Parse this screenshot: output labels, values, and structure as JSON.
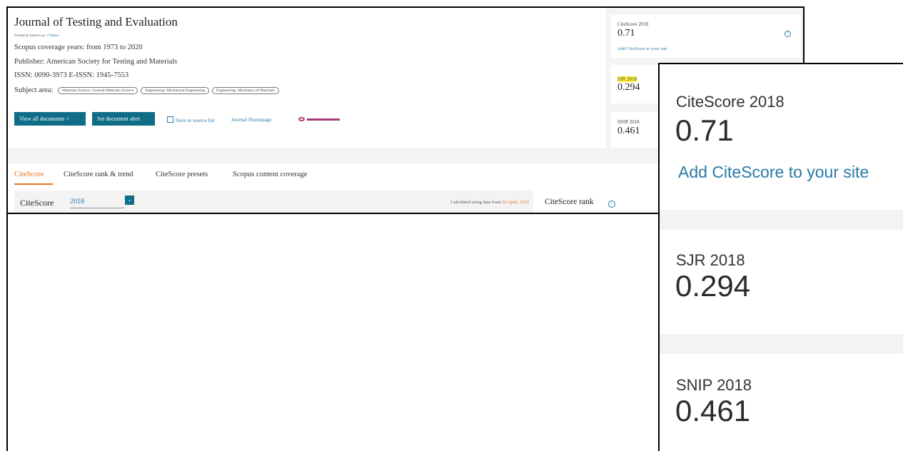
{
  "journal": {
    "title": "Journal of Testing and Evaluation",
    "formerly_label": "Formerly known as:",
    "formerly_link": "J Mater",
    "coverage": "Scopus coverage years:  from 1973 to 2020",
    "publisher": "Publisher:  American Society for Testing and Materials",
    "issn": "ISSN:  0090-3973  E-ISSN:  1945-7553",
    "subject_label": "Subject area:",
    "subjects": [
      "Materials Science: General Materials Science",
      "Engineering: Mechanical Engineering",
      "Engineering: Mechanics of Materials"
    ],
    "view_all_button": "View all documents >",
    "alert_button": "Set document alert",
    "save_link": "Save to source list",
    "homepage_link": "Journal Homepage"
  },
  "metrics_small": {
    "citescore_label": "CiteScore 2018",
    "citescore_value": "0.71",
    "citescore_link": "Add CiteScore to your site",
    "sjr_label": "SJR 2018",
    "sjr_value": "0.294",
    "snip_label": "SNIP 2018",
    "snip_value": "0.461"
  },
  "tabs": [
    {
      "label": "CiteScore",
      "active": true
    },
    {
      "label": "CiteScore rank & trend",
      "active": false
    },
    {
      "label": "CiteScore presets",
      "active": false
    },
    {
      "label": "Scopus content coverage",
      "active": false
    }
  ],
  "citescore_row": {
    "label": "CiteScore",
    "year": "2018",
    "calc_prefix": "Calculated using data from",
    "calc_date": "30 April, 2019",
    "rank_label": "CiteScore rank"
  },
  "zoom": {
    "citescore_label": "CiteScore 2018",
    "citescore_value": "0.71",
    "citescore_link": "Add CiteScore to your site",
    "sjr_label": "SJR 2018",
    "sjr_value": "0.294",
    "snip_label": "SNIP 2018",
    "snip_value": "0.461"
  },
  "colors": {
    "accent_orange": "#e9711c",
    "button_teal": "#0f6d87",
    "link_blue": "#2a7aa8",
    "highlight_yellow": "#fff33a"
  }
}
